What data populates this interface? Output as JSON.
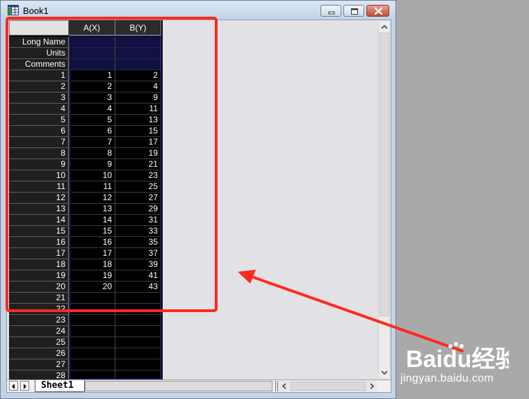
{
  "window": {
    "title": "Book1"
  },
  "grid": {
    "columns": [
      {
        "header": "A(X)"
      },
      {
        "header": "B(Y)"
      }
    ],
    "meta_rows": [
      "Long Name",
      "Units",
      "Comments"
    ],
    "rows": [
      {
        "n": "1",
        "a": "1",
        "b": "2"
      },
      {
        "n": "2",
        "a": "2",
        "b": "4"
      },
      {
        "n": "3",
        "a": "3",
        "b": "9"
      },
      {
        "n": "4",
        "a": "4",
        "b": "11"
      },
      {
        "n": "5",
        "a": "5",
        "b": "13"
      },
      {
        "n": "6",
        "a": "6",
        "b": "15"
      },
      {
        "n": "7",
        "a": "7",
        "b": "17"
      },
      {
        "n": "8",
        "a": "8",
        "b": "19"
      },
      {
        "n": "9",
        "a": "9",
        "b": "21"
      },
      {
        "n": "10",
        "a": "10",
        "b": "23"
      },
      {
        "n": "11",
        "a": "11",
        "b": "25"
      },
      {
        "n": "12",
        "a": "12",
        "b": "27"
      },
      {
        "n": "13",
        "a": "13",
        "b": "29"
      },
      {
        "n": "14",
        "a": "14",
        "b": "31"
      },
      {
        "n": "15",
        "a": "15",
        "b": "33"
      },
      {
        "n": "16",
        "a": "16",
        "b": "35"
      },
      {
        "n": "17",
        "a": "17",
        "b": "37"
      },
      {
        "n": "18",
        "a": "18",
        "b": "39"
      },
      {
        "n": "19",
        "a": "19",
        "b": "41"
      },
      {
        "n": "20",
        "a": "20",
        "b": "43"
      },
      {
        "n": "21",
        "a": "",
        "b": ""
      },
      {
        "n": "22",
        "a": "",
        "b": ""
      },
      {
        "n": "23",
        "a": "",
        "b": ""
      },
      {
        "n": "24",
        "a": "",
        "b": ""
      },
      {
        "n": "25",
        "a": "",
        "b": ""
      },
      {
        "n": "26",
        "a": "",
        "b": ""
      },
      {
        "n": "27",
        "a": "",
        "b": ""
      },
      {
        "n": "28",
        "a": "",
        "b": ""
      }
    ]
  },
  "sheet_tab": {
    "label": "Sheet1"
  },
  "watermark": {
    "logo_text": "Baidu经验",
    "url": "jingyan.baidu.com"
  },
  "colors": {
    "annotation": "#ff2a1d",
    "grid_bg": "#000000",
    "meta_bg": "#111142"
  }
}
